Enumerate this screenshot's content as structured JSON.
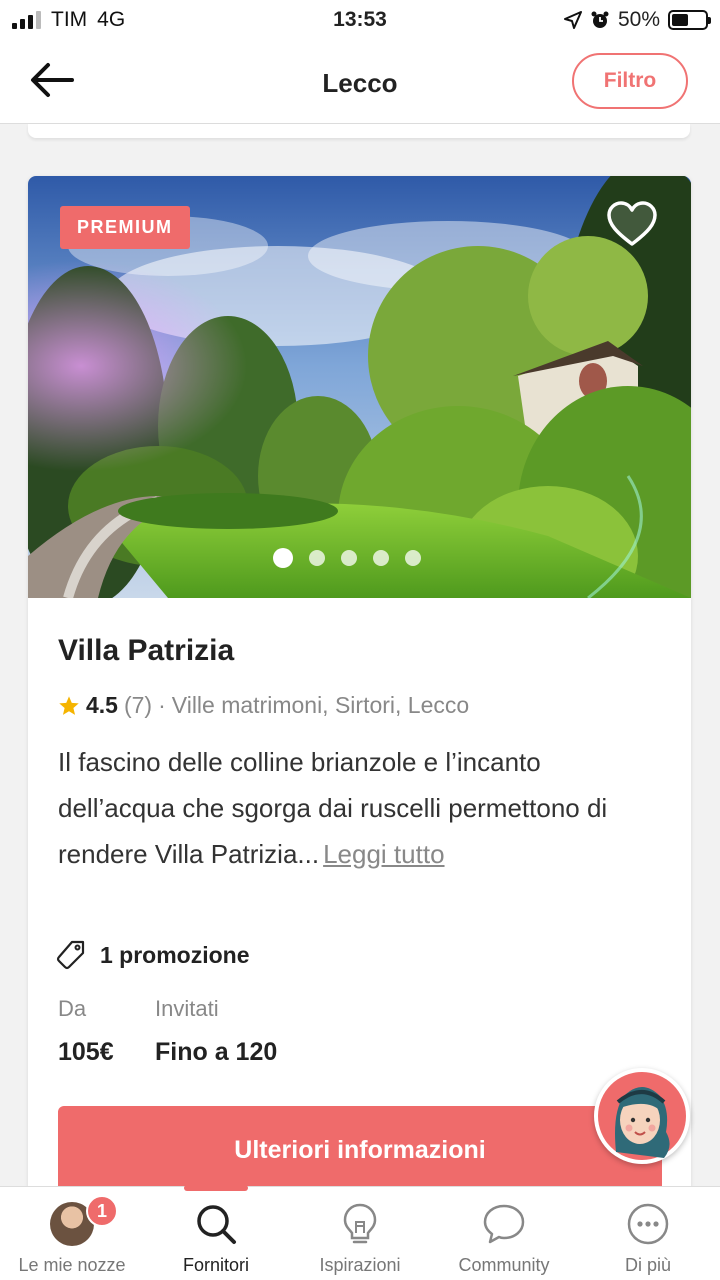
{
  "status_bar": {
    "carrier": "TIM",
    "network": "4G",
    "time": "13:53",
    "battery": "50%",
    "battery_level": 0.5
  },
  "nav": {
    "title": "Lecco",
    "filter_label": "Filtro",
    "back_icon": "arrow-left-icon"
  },
  "listing": {
    "badge": "PREMIUM",
    "photo_count": 5,
    "photo_active_index": 0,
    "title": "Villa Patrizia",
    "rating": "4.5",
    "reviews": "(7)",
    "separator": "·",
    "category": "Ville matrimoni, Sirtori, Lecco",
    "description": "Il fascino delle colline brianzole e l’incanto dell’acqua che sgorga dai ruscelli permettono di rendere Villa Patrizia...",
    "read_more": "Leggi tutto",
    "promotion": "1 promozione",
    "price_label": "Da",
    "price_value": "105€",
    "guests_label": "Invitati",
    "guests_value": "Fino a 120",
    "cta_label": "Ulteriori informazioni"
  },
  "tabbar": {
    "items": [
      {
        "label": "Le mie nozze",
        "icon": "avatar",
        "badge": "1"
      },
      {
        "label": "Fornitori",
        "icon": "search-icon",
        "active": true
      },
      {
        "label": "Ispirazioni",
        "icon": "lightbulb-icon"
      },
      {
        "label": "Community",
        "icon": "chat-bubble-icon"
      },
      {
        "label": "Di più",
        "icon": "more-icon"
      }
    ]
  },
  "colors": {
    "accent": "#ef6b6b",
    "star": "#f5b400"
  }
}
